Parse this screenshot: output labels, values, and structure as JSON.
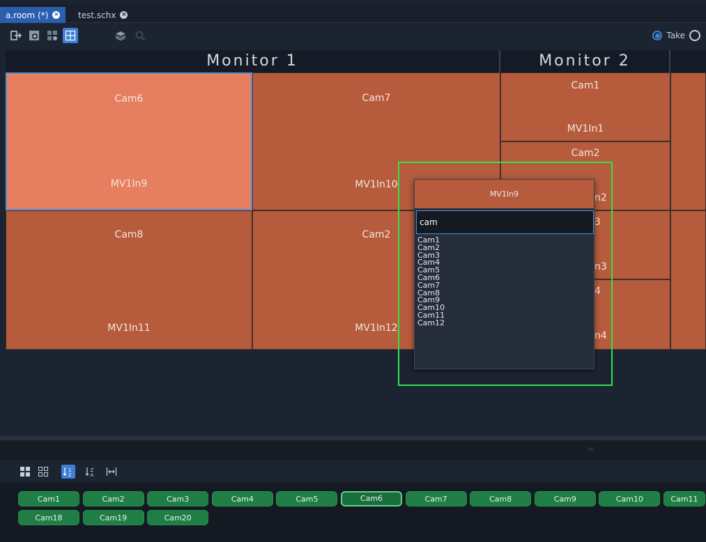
{
  "tabs": [
    {
      "label": "a.room (*)"
    },
    {
      "label": "test.schx"
    }
  ],
  "toolbar": {
    "icons": [
      "exit-icon",
      "add-tile-icon",
      "grid-settings-icon",
      "layout-icon",
      "layers-icon",
      "zoom-icon"
    ],
    "take_label": "Take"
  },
  "monitors": [
    {
      "label": "Monitor 1"
    },
    {
      "label": "Monitor 2"
    }
  ],
  "tiles": {
    "t1": {
      "source": "Cam6",
      "input": "MV1In9"
    },
    "t2": {
      "source": "Cam7",
      "input": "MV1In10"
    },
    "t3": {
      "source": "Cam8",
      "input": "MV1In11"
    },
    "t4": {
      "source": "Cam2",
      "input": "MV1In12"
    },
    "m2a": {
      "source": "Cam1",
      "input": "MV1In1"
    },
    "m2b": {
      "source": "Cam2",
      "input": "n2"
    },
    "m2c": {
      "source": "3",
      "input": "n3"
    },
    "m2d": {
      "source": "4",
      "input": "n4"
    }
  },
  "popup": {
    "title": "MV1In9",
    "search_value": "cam",
    "options": [
      "Cam1",
      "Cam2",
      "Cam3",
      "Cam4",
      "Cam5",
      "Cam6",
      "Cam7",
      "Cam8",
      "Cam9",
      "Cam10",
      "Cam11",
      "Cam12"
    ]
  },
  "sources_row1": [
    "Cam1",
    "Cam2",
    "Cam3",
    "Cam4",
    "Cam5",
    "Cam6",
    "Cam7",
    "Cam8",
    "Cam9",
    "Cam10",
    "Cam11"
  ],
  "sources_row2": [
    "Cam18",
    "Cam19",
    "Cam20"
  ],
  "selected_source": "Cam6",
  "colors": {
    "tile": "#b75b3d",
    "tile_selected": "#e57f5f",
    "source_button": "#1f7d45",
    "accent": "#3d7fd6",
    "highlight": "#2fe34a"
  }
}
